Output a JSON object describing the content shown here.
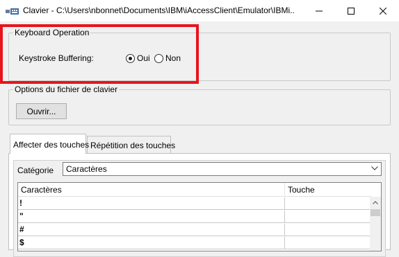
{
  "window": {
    "title": "Clavier - C:\\Users\\nbonnet\\Documents\\IBM\\iAccessClient\\Emulator\\IBMi...",
    "icon": "keyboard-app-icon"
  },
  "keyboard_operation": {
    "legend": "Keyboard Operation",
    "buffering_label": "Keystroke Buffering:",
    "options": [
      {
        "label": "Oui",
        "selected": true
      },
      {
        "label": "Non",
        "selected": false
      }
    ]
  },
  "file_options": {
    "legend": "Options du fichier de clavier",
    "open_button": "Ouvrir..."
  },
  "tabs": [
    {
      "label": "Affecter des touches",
      "active": true
    },
    {
      "label": "Répétition des touches",
      "active": false
    }
  ],
  "category": {
    "label": "Catégorie",
    "value": "Caractères"
  },
  "list": {
    "columns": [
      "Caractères",
      "Touche"
    ],
    "rows": [
      {
        "char": "!",
        "key": ""
      },
      {
        "char": "\"",
        "key": ""
      },
      {
        "char": "#",
        "key": ""
      },
      {
        "char": "$",
        "key": ""
      }
    ]
  },
  "colors": {
    "highlight": "#e8141c",
    "window_bg": "#f0f0f0"
  }
}
